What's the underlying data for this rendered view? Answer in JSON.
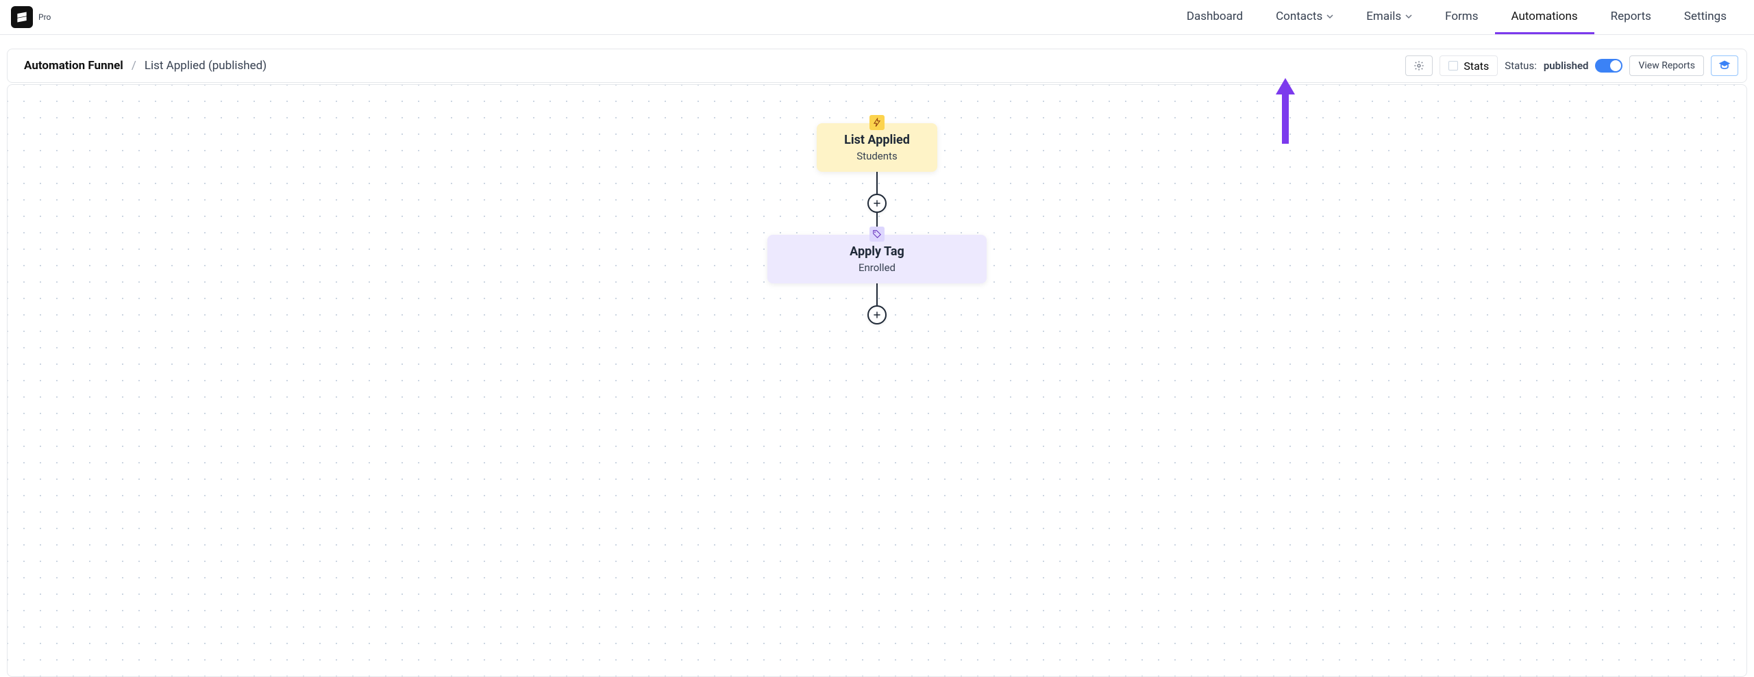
{
  "brand": {
    "badge": "Pro"
  },
  "nav": {
    "dashboard": "Dashboard",
    "contacts": "Contacts",
    "emails": "Emails",
    "forms": "Forms",
    "automations": "Automations",
    "reports": "Reports",
    "settings": "Settings"
  },
  "breadcrumb": {
    "root": "Automation Funnel",
    "sep": "/",
    "current": "List Applied (published)"
  },
  "toolbar": {
    "stats_label": "Stats",
    "status_label": "Status:",
    "status_value": "published",
    "view_reports": "View Reports"
  },
  "flow": {
    "trigger": {
      "title": "List Applied",
      "subtitle": "Students"
    },
    "action1": {
      "title": "Apply Tag",
      "subtitle": "Enrolled"
    }
  },
  "icons": {
    "gear": "gear-icon",
    "graduation": "graduation-cap-icon",
    "chevron_down": "chevron-down-icon",
    "bolt": "bolt-icon",
    "tag": "tag-icon",
    "plus": "plus-icon"
  },
  "colors": {
    "accent": "#7c3aed",
    "switch_on": "#3b82f6",
    "trigger_bg": "#fef3c7",
    "action_bg": "#ede9fe"
  }
}
